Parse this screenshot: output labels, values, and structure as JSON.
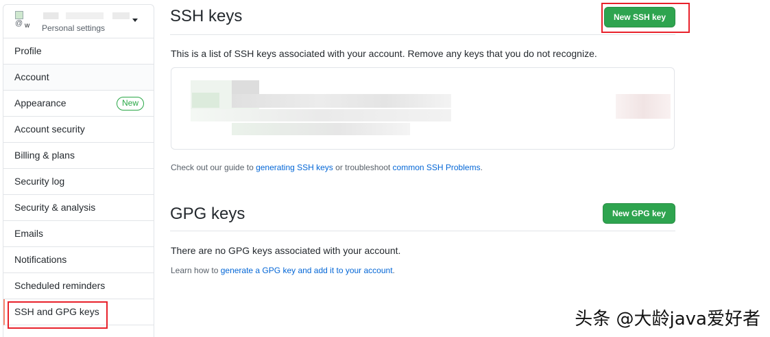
{
  "sidebar": {
    "avatar_text": "@",
    "avatar_letter": "w",
    "subtitle": "Personal settings",
    "items": [
      {
        "label": "Profile"
      },
      {
        "label": "Account"
      },
      {
        "label": "Appearance",
        "badge": "New"
      },
      {
        "label": "Account security"
      },
      {
        "label": "Billing & plans"
      },
      {
        "label": "Security log"
      },
      {
        "label": "Security & analysis"
      },
      {
        "label": "Emails"
      },
      {
        "label": "Notifications"
      },
      {
        "label": "Scheduled reminders"
      },
      {
        "label": "SSH and GPG keys"
      }
    ]
  },
  "ssh": {
    "title": "SSH keys",
    "new_button": "New SSH key",
    "description": "This is a list of SSH keys associated with your account. Remove any keys that you do not recognize.",
    "guide_prefix": "Check out our guide to ",
    "guide_link": "generating SSH keys",
    "guide_middle": " or troubleshoot ",
    "problems_link": "common SSH Problems",
    "guide_suffix": "."
  },
  "gpg": {
    "title": "GPG keys",
    "new_button": "New GPG key",
    "empty_text": "There are no GPG keys associated with your account.",
    "learn_prefix": "Learn how to ",
    "learn_link": "generate a GPG key and add it to your account",
    "learn_suffix": "."
  },
  "watermark": "头条 @大龄java爱好者",
  "colors": {
    "accent_green": "#2ea44f",
    "link_blue": "#0366d6",
    "highlight_red": "#e8202a",
    "selected_marker": "#f9826c"
  }
}
